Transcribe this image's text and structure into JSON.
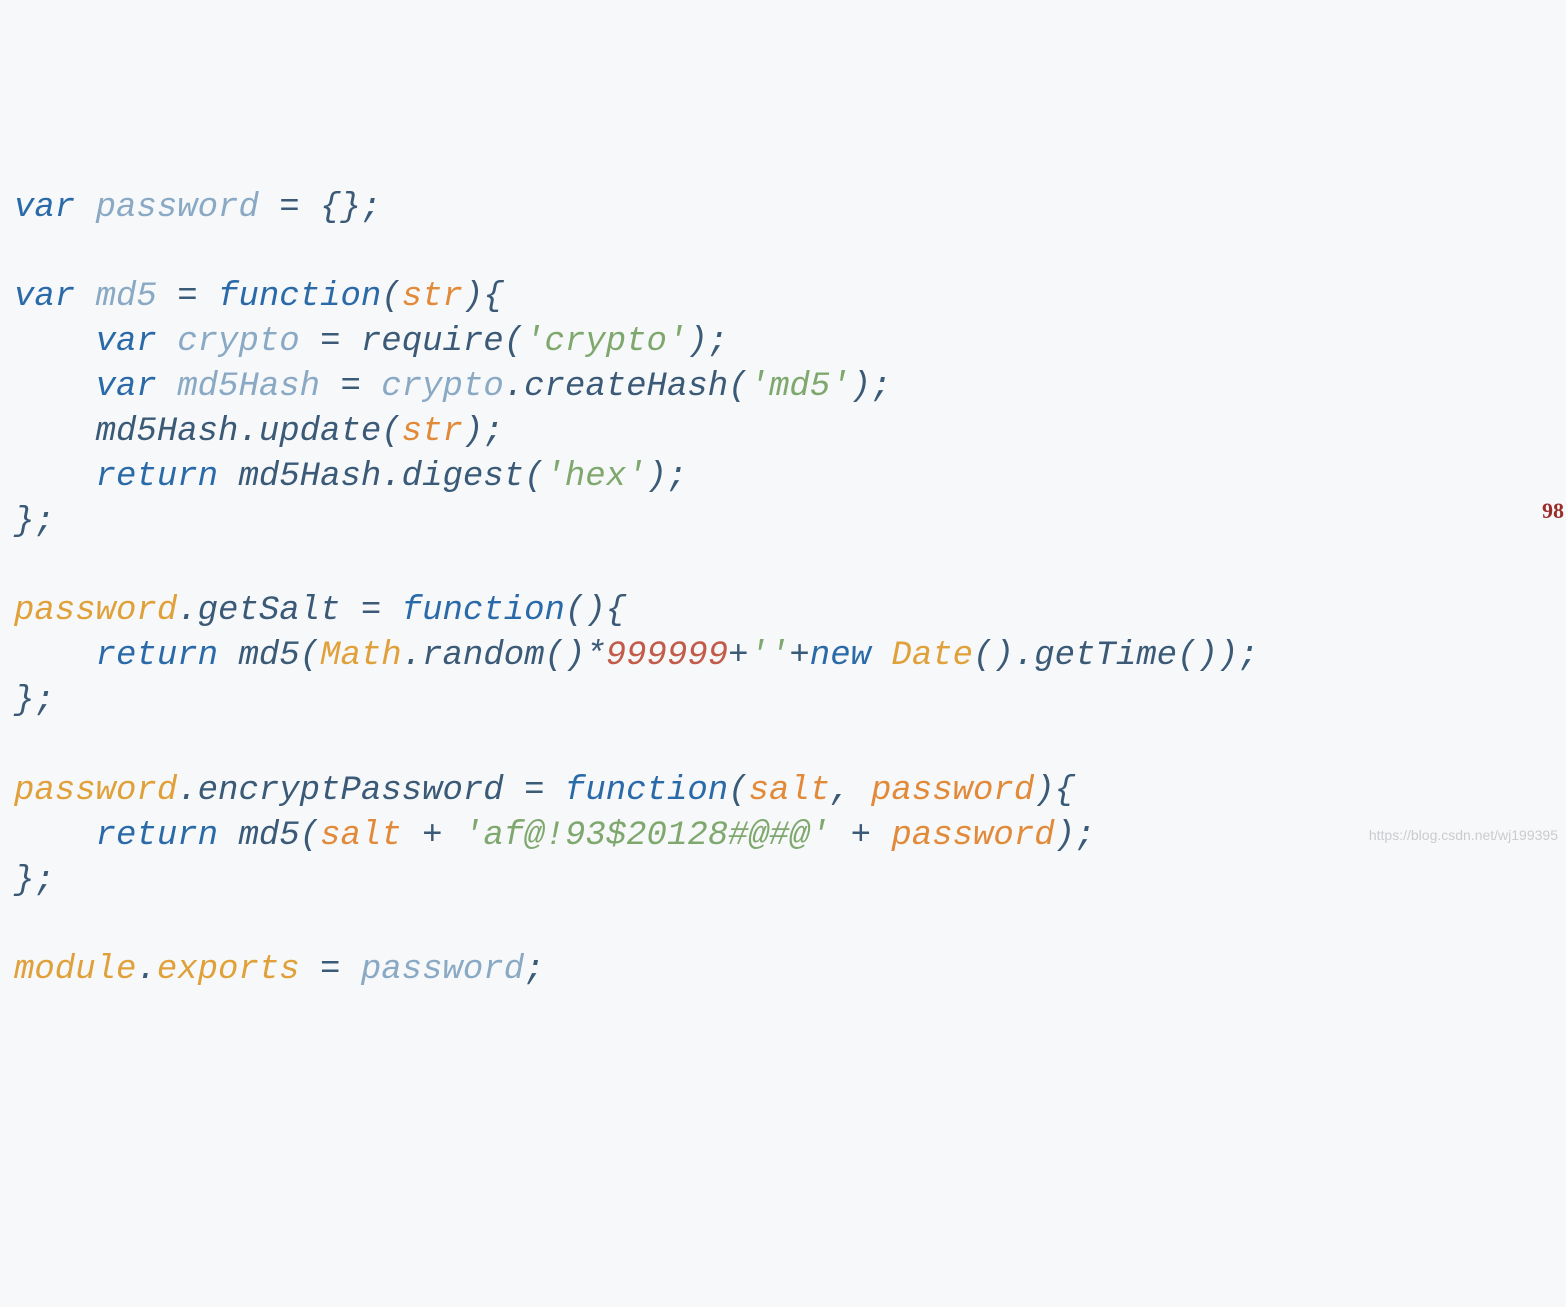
{
  "code": {
    "tokens": [
      [
        {
          "t": "var",
          "c": "kw"
        },
        {
          "t": " ",
          "c": ""
        },
        {
          "t": "password",
          "c": "var-name"
        },
        {
          "t": " = {};",
          "c": "punct"
        }
      ],
      [],
      [
        {
          "t": "var",
          "c": "kw"
        },
        {
          "t": " ",
          "c": ""
        },
        {
          "t": "md5",
          "c": "var-name"
        },
        {
          "t": " = ",
          "c": "op"
        },
        {
          "t": "function",
          "c": "func"
        },
        {
          "t": "(",
          "c": "paren"
        },
        {
          "t": "str",
          "c": "param"
        },
        {
          "t": "){",
          "c": "paren"
        }
      ],
      [
        {
          "t": "    ",
          "c": ""
        },
        {
          "t": "var",
          "c": "kw"
        },
        {
          "t": " ",
          "c": ""
        },
        {
          "t": "crypto",
          "c": "var-name"
        },
        {
          "t": " = require(",
          "c": "ident"
        },
        {
          "t": "'crypto'",
          "c": "str"
        },
        {
          "t": ");",
          "c": "punct"
        }
      ],
      [
        {
          "t": "    ",
          "c": ""
        },
        {
          "t": "var",
          "c": "kw"
        },
        {
          "t": " ",
          "c": ""
        },
        {
          "t": "md5Hash",
          "c": "var-name"
        },
        {
          "t": " = ",
          "c": "op"
        },
        {
          "t": "crypto",
          "c": "var-name"
        },
        {
          "t": ".createHash(",
          "c": "member"
        },
        {
          "t": "'md5'",
          "c": "str"
        },
        {
          "t": ");",
          "c": "punct"
        }
      ],
      [
        {
          "t": "    md5Hash.update(",
          "c": "member"
        },
        {
          "t": "str",
          "c": "param"
        },
        {
          "t": ");",
          "c": "punct"
        }
      ],
      [
        {
          "t": "    ",
          "c": ""
        },
        {
          "t": "return",
          "c": "kw"
        },
        {
          "t": " md5Hash.digest(",
          "c": "member"
        },
        {
          "t": "'hex'",
          "c": "str"
        },
        {
          "t": ");",
          "c": "punct"
        }
      ],
      [
        {
          "t": "};",
          "c": "punct"
        }
      ],
      [],
      [
        {
          "t": "password",
          "c": "prop"
        },
        {
          "t": ".",
          "c": "punct"
        },
        {
          "t": "getSalt",
          "c": "member"
        },
        {
          "t": " = ",
          "c": "op"
        },
        {
          "t": "function",
          "c": "func"
        },
        {
          "t": "(){",
          "c": "paren"
        }
      ],
      [
        {
          "t": "    ",
          "c": ""
        },
        {
          "t": "return",
          "c": "kw"
        },
        {
          "t": " md5(",
          "c": "member"
        },
        {
          "t": "Math",
          "c": "builtin"
        },
        {
          "t": ".random()*",
          "c": "member"
        },
        {
          "t": "999999",
          "c": "num"
        },
        {
          "t": "+",
          "c": "op"
        },
        {
          "t": "''",
          "c": "str"
        },
        {
          "t": "+",
          "c": "op"
        },
        {
          "t": "new",
          "c": "kw"
        },
        {
          "t": " ",
          "c": ""
        },
        {
          "t": "Date",
          "c": "builtin"
        },
        {
          "t": "().getTime());",
          "c": "member"
        }
      ],
      [
        {
          "t": "};",
          "c": "punct"
        }
      ],
      [],
      [
        {
          "t": "password",
          "c": "prop"
        },
        {
          "t": ".",
          "c": "punct"
        },
        {
          "t": "encryptPassword",
          "c": "member"
        },
        {
          "t": " = ",
          "c": "op"
        },
        {
          "t": "function",
          "c": "func"
        },
        {
          "t": "(",
          "c": "paren"
        },
        {
          "t": "salt",
          "c": "param"
        },
        {
          "t": ", ",
          "c": "punct"
        },
        {
          "t": "password",
          "c": "param"
        },
        {
          "t": "){",
          "c": "paren"
        }
      ],
      [
        {
          "t": "    ",
          "c": ""
        },
        {
          "t": "return",
          "c": "kw"
        },
        {
          "t": " md5(",
          "c": "member"
        },
        {
          "t": "salt",
          "c": "param"
        },
        {
          "t": " + ",
          "c": "op"
        },
        {
          "t": "'af@!93$20128#@#@'",
          "c": "str"
        },
        {
          "t": " + ",
          "c": "op"
        },
        {
          "t": "password",
          "c": "param"
        },
        {
          "t": ");",
          "c": "punct"
        }
      ],
      [
        {
          "t": "};",
          "c": "punct"
        }
      ],
      [],
      [
        {
          "t": "module",
          "c": "prop"
        },
        {
          "t": ".",
          "c": "punct"
        },
        {
          "t": "exports",
          "c": "prop"
        },
        {
          "t": " = ",
          "c": "op"
        },
        {
          "t": "password",
          "c": "var-name"
        },
        {
          "t": ";",
          "c": "punct"
        }
      ]
    ]
  },
  "overflow_marker": "98",
  "watermark": "https://blog.csdn.net/wj199395"
}
